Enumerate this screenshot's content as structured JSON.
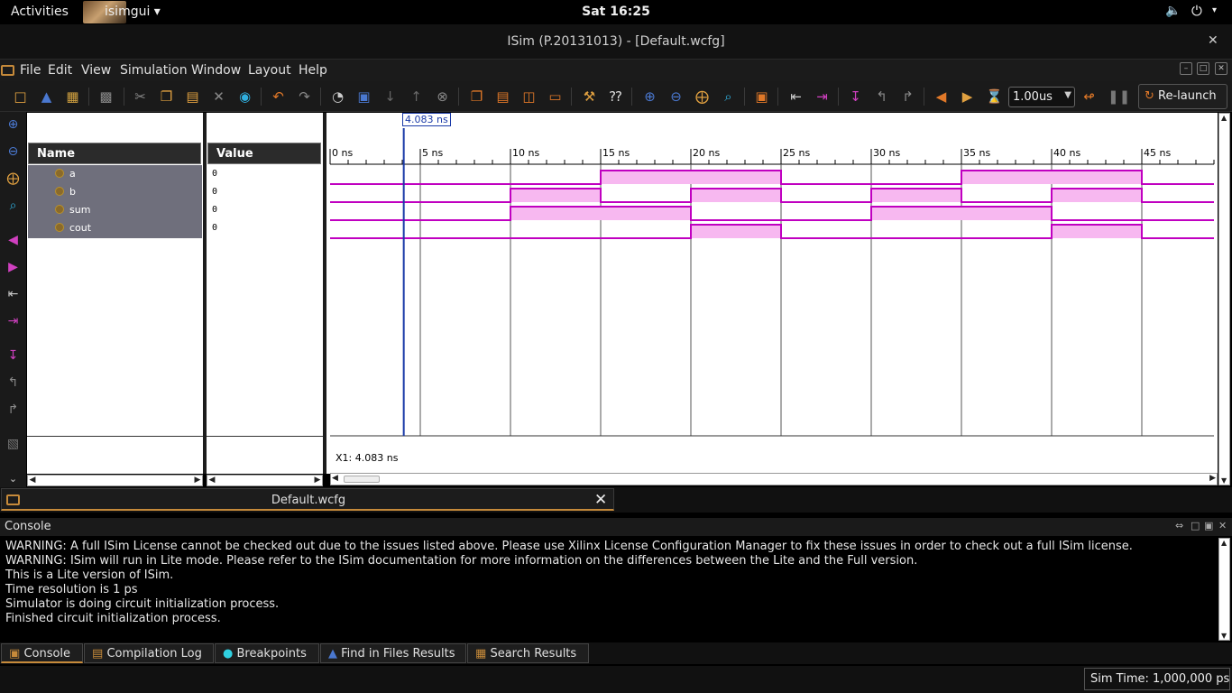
{
  "system_bar": {
    "activities": "Activities",
    "app_name": "isimgui ▾",
    "clock": "Sat 16:25",
    "volume_icon": "🔈",
    "power_icon": "⏻",
    "power_arrow": "▾"
  },
  "window": {
    "title": "ISim (P.20131013) - [Default.wcfg]",
    "close": "✕"
  },
  "menu": {
    "items": [
      "File",
      "Edit",
      "View",
      "Simulation",
      "Window",
      "Layout",
      "Help"
    ],
    "win_minimize": "–",
    "win_restore": "□",
    "win_close": "✕"
  },
  "toolbar": {
    "zoom_value": "1.00us",
    "relaunch_icon": "↻",
    "relaunch_label": "Re-launch"
  },
  "panels": {
    "name_header": "Name",
    "value_header": "Value",
    "signals": [
      {
        "name": "a",
        "value": "0"
      },
      {
        "name": "b",
        "value": "0"
      },
      {
        "name": "sum",
        "value": "0"
      },
      {
        "name": "cout",
        "value": "0"
      }
    ]
  },
  "waveform": {
    "cursor_label": "4.083 ns",
    "x1_label": "X1: 4.083 ns",
    "cursor_ns": 4.083,
    "time_range_ns": [
      0,
      49
    ],
    "time_labels": [
      "0 ns",
      "5 ns",
      "10 ns",
      "15 ns",
      "20 ns",
      "25 ns",
      "30 ns",
      "35 ns",
      "40 ns",
      "45 ns"
    ],
    "wave_color": "#c000c0",
    "high_fill": "#f7b8f0",
    "cursor_color": "#1a3aa8",
    "signals": [
      {
        "name": "a",
        "high_intervals_ns": [
          [
            15,
            25
          ],
          [
            35,
            45
          ]
        ]
      },
      {
        "name": "b",
        "high_intervals_ns": [
          [
            10,
            15
          ],
          [
            20,
            25
          ],
          [
            30,
            35
          ],
          [
            40,
            45
          ]
        ]
      },
      {
        "name": "sum",
        "high_intervals_ns": [
          [
            10,
            20
          ],
          [
            30,
            40
          ]
        ]
      },
      {
        "name": "cout",
        "high_intervals_ns": [
          [
            20,
            25
          ],
          [
            40,
            45
          ]
        ]
      }
    ]
  },
  "document_tab": {
    "label": "Default.wcfg",
    "close": "✕"
  },
  "console": {
    "title": "Console",
    "lines": [
      "WARNING: A full ISim License cannot be checked out due to the issues listed above. Please use Xilinx License Configuration Manager to fix these issues in order to check out a full ISim license.",
      "WARNING: ISim will run in Lite mode. Please refer to the ISim documentation for more information on the differences between the Lite and the Full version.",
      "This is a Lite version of ISim.",
      "Time resolution is 1 ps",
      "Simulator is doing circuit initialization process.",
      "Finished circuit initialization process."
    ]
  },
  "bottom_tabs": [
    {
      "label": "Console",
      "icon": "▣"
    },
    {
      "label": "Compilation Log",
      "icon": "▤"
    },
    {
      "label": "Breakpoints",
      "icon": "●"
    },
    {
      "label": "Find in Files Results",
      "icon": "▲"
    },
    {
      "label": "Search Results",
      "icon": "▦"
    }
  ],
  "status": {
    "sim_time": "Sim Time: 1,000,000 ps"
  },
  "colors": {
    "accent": "#c68a3a",
    "icon_orange": "#e07828",
    "icon_blue": "#4a78d0",
    "icon_magenta": "#d040c0"
  }
}
